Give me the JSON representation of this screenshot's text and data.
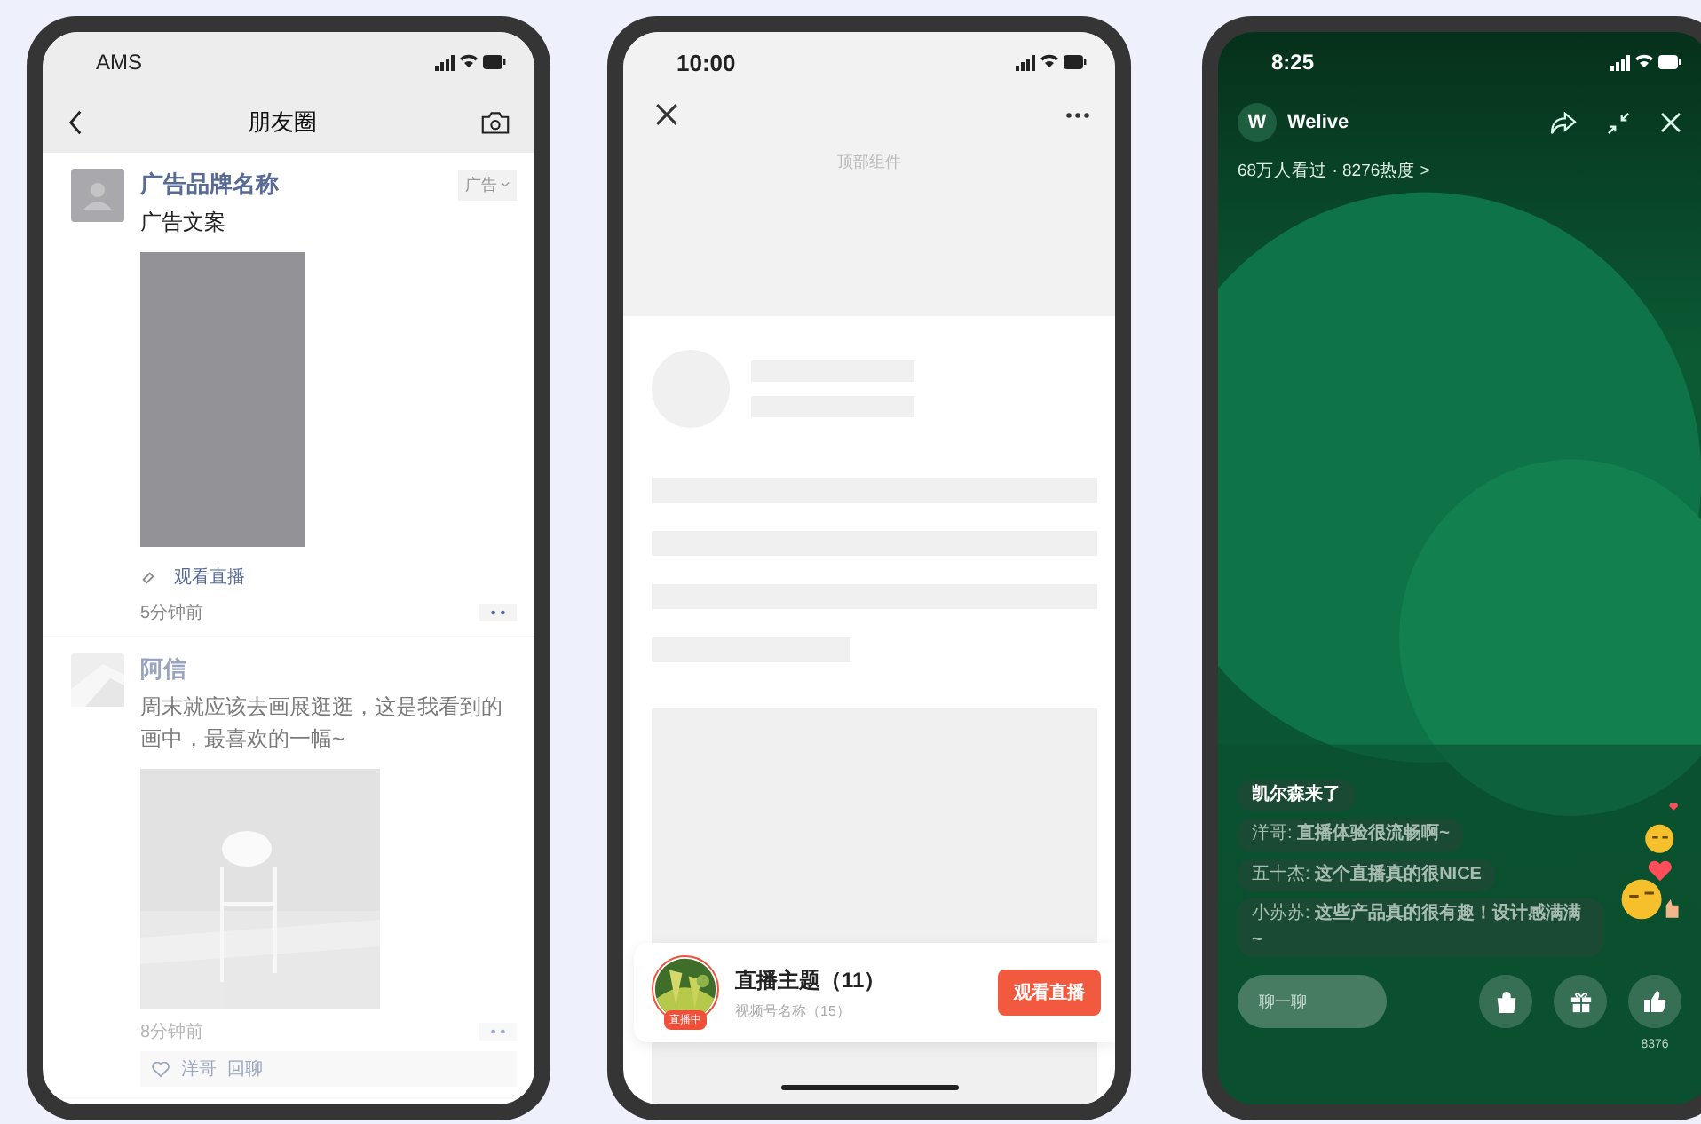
{
  "moments": {
    "status_bar": {
      "carrier": "AMS"
    },
    "nav": {
      "title": "朋友圈"
    },
    "posts": [
      {
        "kind": "ad",
        "name": "广告品牌名称",
        "tag": "广告",
        "text": "广告文案",
        "link": "观看直播",
        "time": "5分钟前",
        "dimmed": false
      },
      {
        "name": "阿信",
        "text": "周末就应该去画展逛逛，这是我看到的画中，最喜欢的一幅~",
        "time": "8分钟前",
        "likes": "洋哥",
        "reply": "回聊",
        "dimmed": true
      }
    ]
  },
  "channel_page": {
    "status_bar": {
      "time": "10:00"
    },
    "top_label": "顶部组件",
    "live_card": {
      "badge": "直播中",
      "title": "直播主题（11）",
      "subtitle": "视频号名称（15）",
      "button": "观看直播"
    }
  },
  "live_room": {
    "status_bar": {
      "time": "8:25"
    },
    "host": {
      "initial": "W",
      "name": "Welive"
    },
    "stats": "68万人看过 · 8276热度 >",
    "comments": [
      {
        "text": "凯尔森来了"
      },
      {
        "text": "洋哥: **直播体验很流畅啊~**"
      },
      {
        "text": "五十杰: **这个直播真的很NICE**"
      },
      {
        "text": "小苏苏: **这些产品真的很有趣！设计感满满~**"
      }
    ],
    "chat_input": {
      "placeholder": "聊一聊"
    },
    "like_count": "8376"
  }
}
